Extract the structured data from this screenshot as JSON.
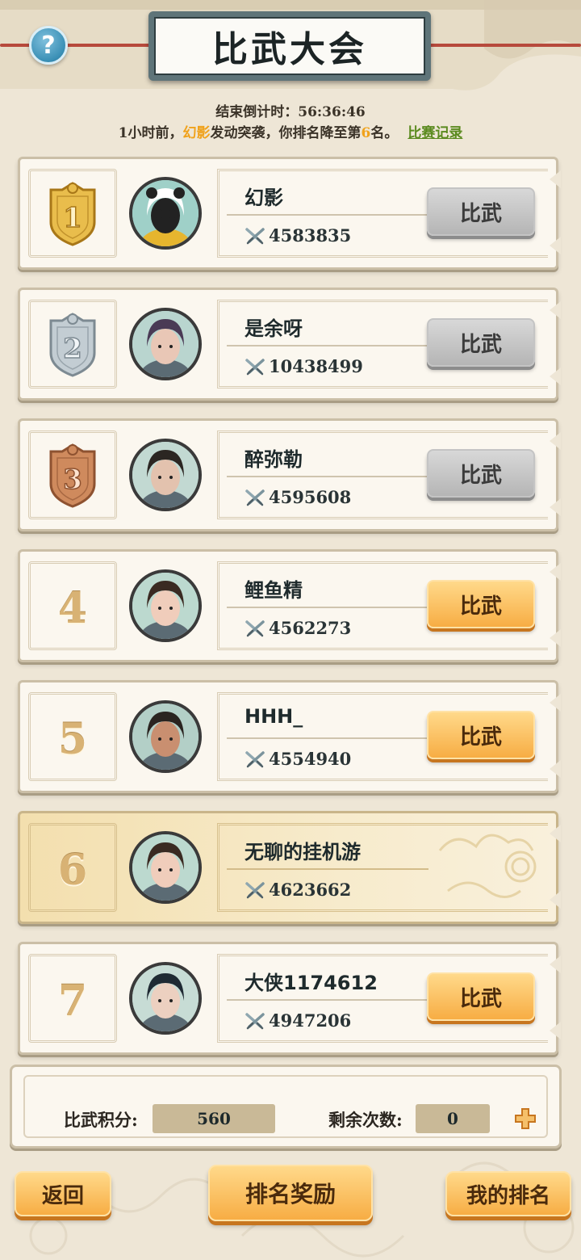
{
  "header": {
    "title": "比武大会",
    "help_glyph": "?",
    "countdown": "结束倒计时：56:36:46",
    "notice": {
      "prefix": "1小时前，",
      "attacker": "幻影",
      "middle": "发动突袭，你排名降至第",
      "rank": "6",
      "suffix": "名。",
      "link": "比赛记录"
    }
  },
  "ranking": [
    {
      "rank": "1",
      "medal": "gold",
      "name": "幻影",
      "power": "4583835",
      "button": "比武",
      "button_state": "disabled",
      "avatar": "panda"
    },
    {
      "rank": "2",
      "medal": "silver",
      "name": "是余呀",
      "power": "10438499",
      "button": "比武",
      "button_state": "disabled",
      "avatar": "woman-purple"
    },
    {
      "rank": "3",
      "medal": "bronze",
      "name": "醉弥勒",
      "power": "4595608",
      "button": "比武",
      "button_state": "disabled",
      "avatar": "man-crown"
    },
    {
      "rank": "4",
      "medal": "",
      "name": "鲤鱼精",
      "power": "4562273",
      "button": "比武",
      "button_state": "active",
      "avatar": "girl"
    },
    {
      "rank": "5",
      "medal": "",
      "name": "HHH_",
      "power": "4554940",
      "button": "比武",
      "button_state": "active",
      "avatar": "warrior"
    },
    {
      "rank": "6",
      "medal": "",
      "name": "无聊的挂机游",
      "power": "4623662",
      "button": "",
      "button_state": "self",
      "avatar": "girl"
    },
    {
      "rank": "7",
      "medal": "",
      "name": "大侠1174612",
      "power": "4947206",
      "button": "比武",
      "button_state": "active",
      "avatar": "swordsman"
    }
  ],
  "score": {
    "points_label": "比武积分:",
    "points_value": "560",
    "remaining_label": "剩余次数:",
    "remaining_value": "0"
  },
  "footer": {
    "back": "返回",
    "rewards": "排名奖励",
    "my_rank": "我的排名"
  },
  "colors": {
    "background": "#eee6d6",
    "accent_orange": "#f7ad44",
    "highlight_name": "#f0a21b",
    "link_green": "#5a8a1e",
    "gold": "#e6b84a",
    "silver": "#b9c3c9",
    "bronze": "#c8845a"
  },
  "icons": [
    "help-icon",
    "sword-power-icon",
    "plus-icon",
    "medal-icon"
  ]
}
